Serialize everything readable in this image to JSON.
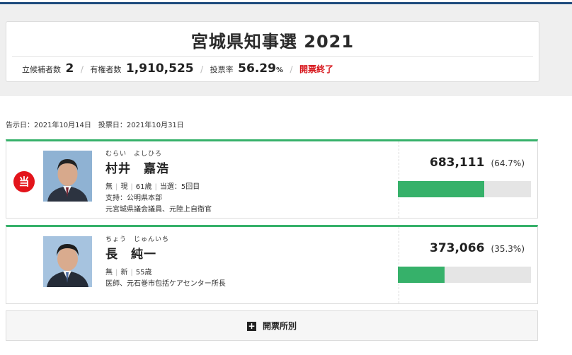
{
  "header": {
    "title": "宮城県知事選 2021",
    "stats": {
      "candidates_label": "立候補者数",
      "candidates_value": "2",
      "electorate_label": "有権者数",
      "electorate_value": "1,910,525",
      "turnout_label": "投票率",
      "turnout_value": "56.29",
      "turnout_unit": "%",
      "status": "開票終了"
    }
  },
  "dates": "告示日：2021年10月14日　投票日：2021年10月31日",
  "candidates": [
    {
      "kana": "むらい　よしひろ",
      "name": "村井　嘉浩",
      "winner_badge": "当",
      "party": "無",
      "incumbency": "現",
      "age": "61歳",
      "wins": "当選：5回目",
      "support": "支持：公明県本部",
      "career": "元宮城県議会議員、元陸上自衛官",
      "votes": "683,111",
      "share_label": "(64.7%)",
      "share": 64.7
    },
    {
      "kana": "ちょう　じゅんいち",
      "name": "長　純一",
      "party": "無",
      "incumbency": "新",
      "age": "55歳",
      "career": "医師、元石巻市包括ケアセンター所長",
      "votes": "373,066",
      "share_label": "(35.3%)",
      "share": 35.3
    }
  ],
  "tally_button": {
    "label": "開票所別"
  },
  "colors": {
    "accent": "#36b16a",
    "winner": "#e3141b",
    "status": "#d7141a",
    "topline": "#1e4a7c"
  }
}
